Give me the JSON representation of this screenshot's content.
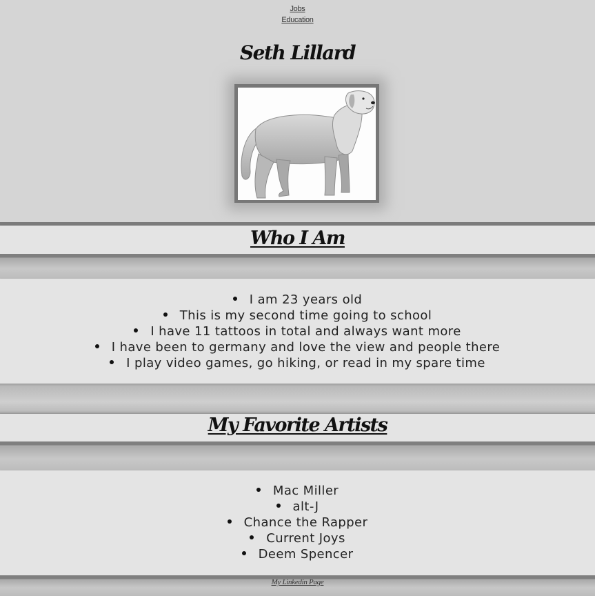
{
  "nav": {
    "links": [
      "Jobs",
      "Education"
    ]
  },
  "site_title": "Seth Lillard",
  "profile_image": {
    "icon": "dog-photo"
  },
  "sections": {
    "who_i_am": {
      "heading": "Who I Am",
      "items": [
        "I am 23 years old",
        "This is my second time going to school",
        "I have 11 tattoos in total and always want more",
        "I have been to germany and love the view and people there",
        "I play video games, go hiking, or read in my spare time"
      ]
    },
    "favorite_artists": {
      "heading": "My Favorite Artists",
      "items": [
        "Mac Miller",
        "alt-J",
        "Chance the Rapper",
        "Current Joys",
        "Deem Spencer"
      ]
    }
  },
  "footer": {
    "link": "My Linkedin Page"
  }
}
